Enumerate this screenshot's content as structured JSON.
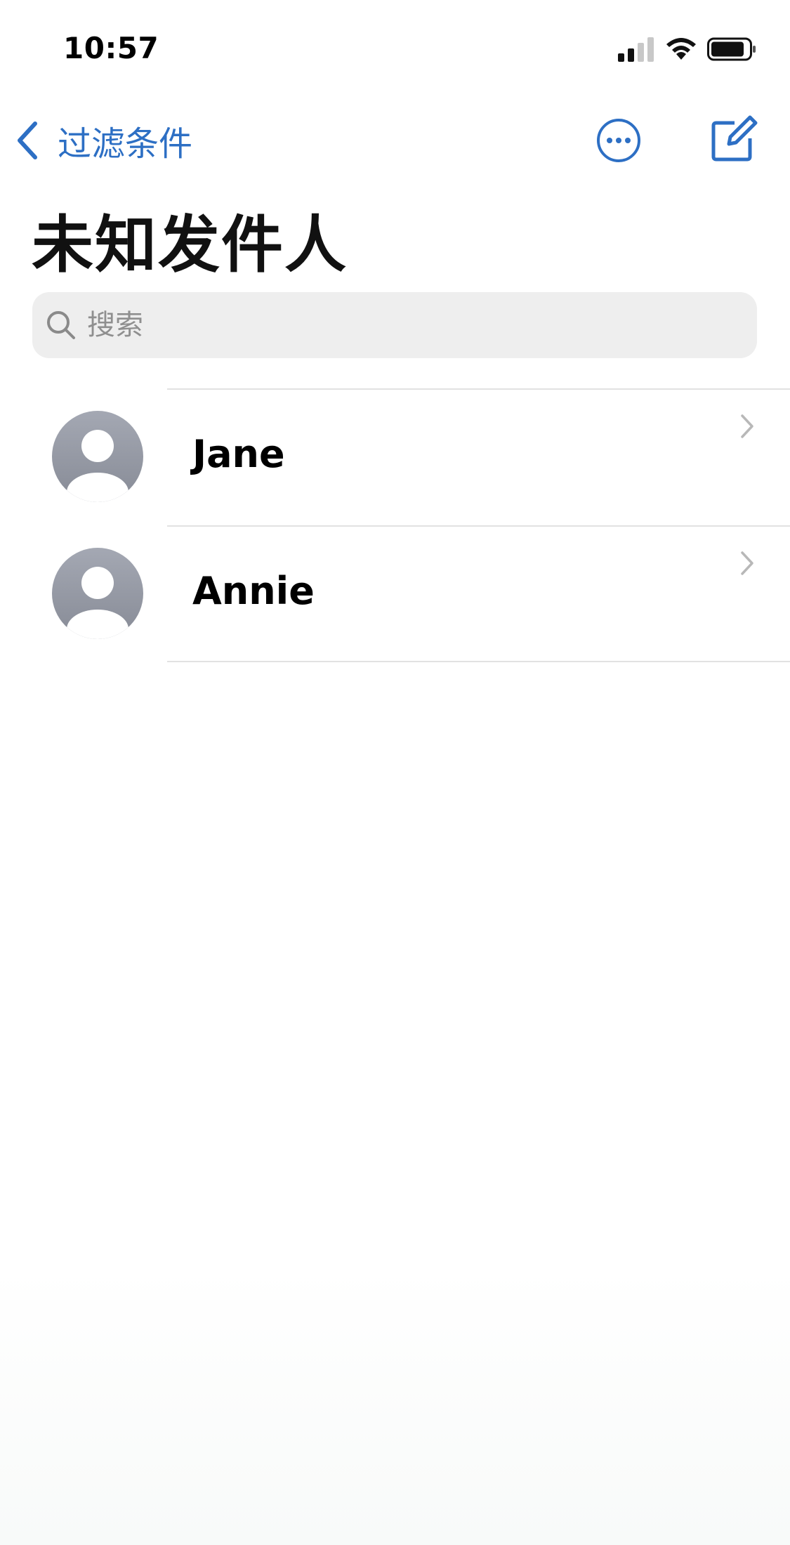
{
  "status_bar": {
    "time": "10:57"
  },
  "nav": {
    "back_label": "过滤条件",
    "accent_color": "#2d6fc4"
  },
  "page": {
    "title": "未知发件人"
  },
  "search": {
    "placeholder": "搜索"
  },
  "contacts": [
    {
      "name": "Jane",
      "icon": "person-avatar-icon"
    },
    {
      "name": "Annie",
      "icon": "person-avatar-icon"
    }
  ]
}
